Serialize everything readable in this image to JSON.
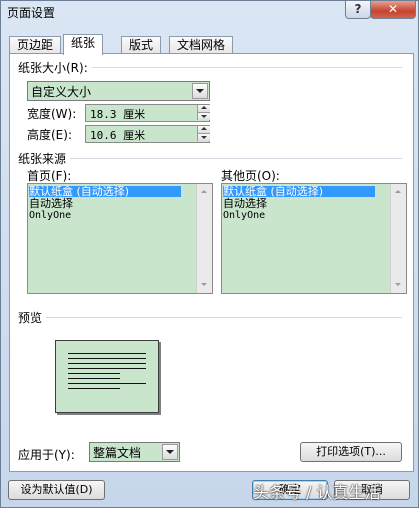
{
  "window": {
    "title": "页面设置",
    "help": "?",
    "close": "✕"
  },
  "tabs": [
    {
      "label": "页边距"
    },
    {
      "label": "纸张"
    },
    {
      "label": "版式"
    },
    {
      "label": "文档网格"
    }
  ],
  "paper_size": {
    "group_label": "纸张大小(R):",
    "selected": "自定义大小",
    "width_label": "宽度(W):",
    "width_value": "18.3 厘米",
    "height_label": "高度(E):",
    "height_value": "10.6 厘米"
  },
  "paper_source": {
    "group_label": "纸张来源",
    "first_page_label": "首页(F):",
    "first_page_items": [
      "默认纸盒 (自动选择)",
      "自动选择",
      "OnlyOne"
    ],
    "other_pages_label": "其他页(O):",
    "other_pages_items": [
      "默认纸盒 (自动选择)",
      "自动选择",
      "OnlyOne"
    ]
  },
  "preview": {
    "label": "预览"
  },
  "apply_to": {
    "label": "应用于(Y):",
    "selected": "整篇文档"
  },
  "buttons": {
    "print_options": "打印选项(T)...",
    "set_default": "设为默认值(D)",
    "ok": "确定",
    "cancel": "取消"
  },
  "watermark": "头条号 / 认真生活"
}
